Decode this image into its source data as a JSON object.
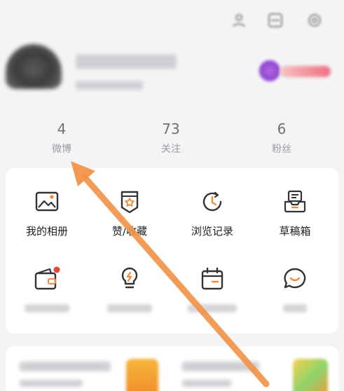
{
  "stats": [
    {
      "count": "4",
      "label": "微博"
    },
    {
      "count": "73",
      "label": "关注"
    },
    {
      "count": "6",
      "label": "粉丝"
    }
  ],
  "grid": [
    {
      "label": "我的相册",
      "icon": "photo-album-icon"
    },
    {
      "label": "赞/收藏",
      "icon": "bookmark-star-icon"
    },
    {
      "label": "浏览记录",
      "icon": "history-clock-icon"
    },
    {
      "label": "草稿箱",
      "icon": "drafts-tray-icon"
    }
  ],
  "second_row_icons": [
    "wallet-icon",
    "lightbulb-icon",
    "calendar-icon",
    "chat-bubble-icon"
  ],
  "colors": {
    "accent": "#f2883a",
    "icon": "#333333",
    "notify": "#e8453c",
    "annotation_arrow": "#f2944a"
  }
}
